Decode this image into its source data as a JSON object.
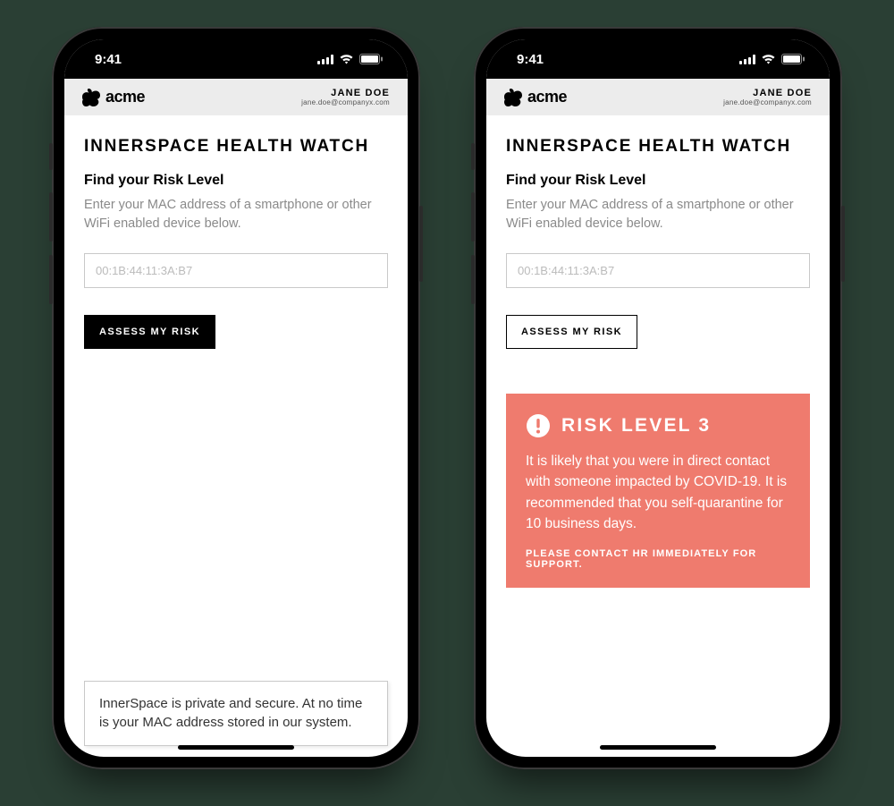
{
  "statusbar": {
    "time": "9:41"
  },
  "header": {
    "brand": "acme",
    "user_name": "JANE DOE",
    "user_email": "jane.doe@companyx.com"
  },
  "page": {
    "title": "INNERSPACE HEALTH WATCH",
    "subheading": "Find your Risk Level",
    "instructions": "Enter your MAC address of a smartphone or other WiFi enabled device below.",
    "mac_placeholder": "00:1B:44:11:3A:B7",
    "assess_label": "ASSESS MY RISK"
  },
  "privacy_notice": "InnerSpace is private and secure. At no time is your MAC address stored in our system.",
  "risk": {
    "title": "RISK LEVEL 3",
    "body": "It is likely that you were in direct contact with someone impacted by COVID-19. It is recommended that you self-quarantine for 10 business days.",
    "contact": "PLEASE CONTACT HR IMMEDIATELY FOR SUPPORT."
  }
}
